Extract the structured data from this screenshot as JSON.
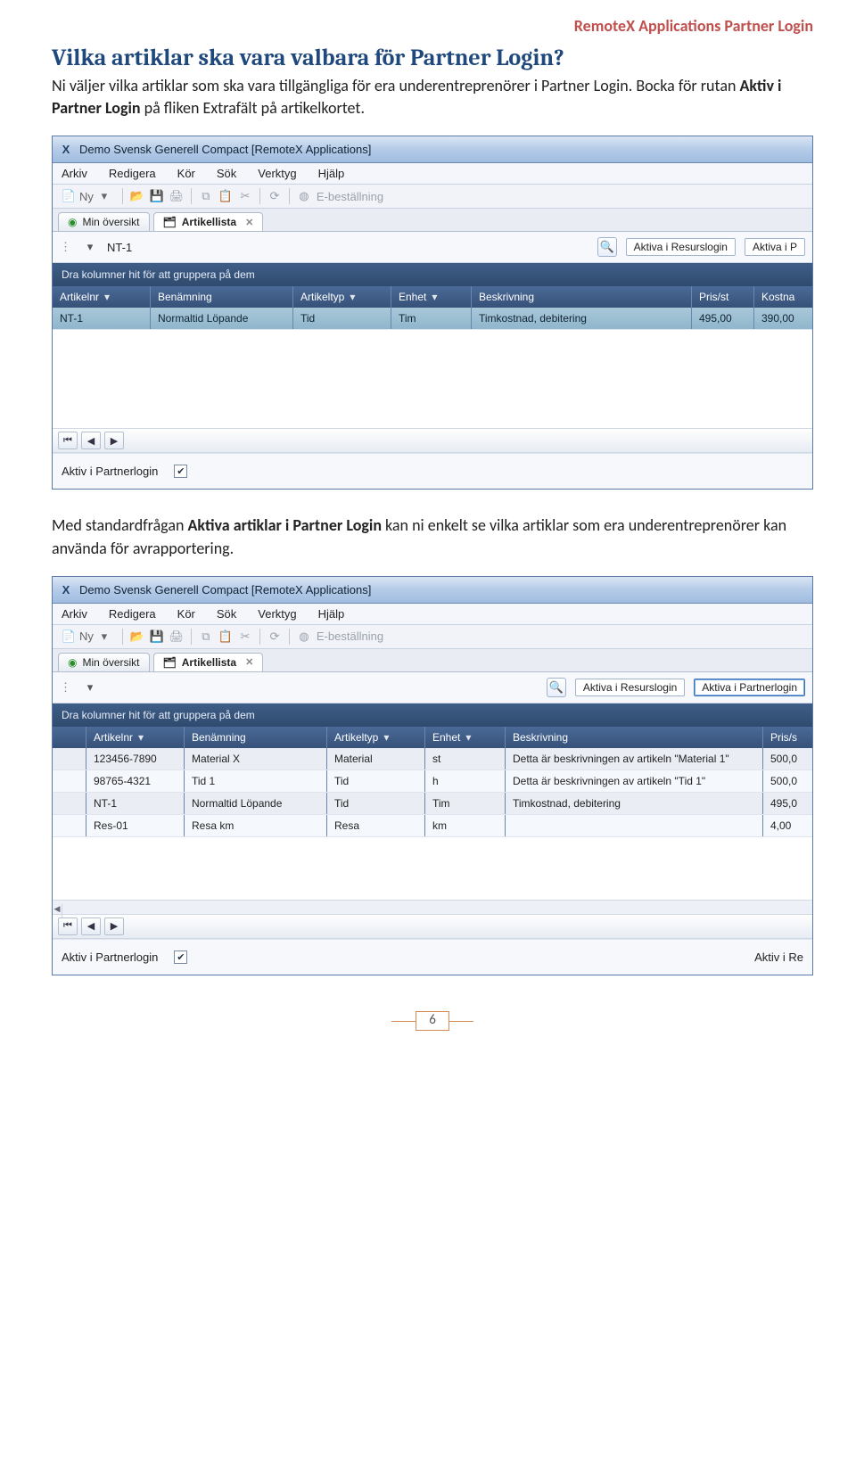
{
  "doc": {
    "header_right": "RemoteX Applications Partner Login",
    "h2": "Vilka artiklar ska vara valbara för Partner Login?",
    "para1_a": "Ni väljer vilka artiklar som ska vara tillgängliga för era underentreprenörer i Partner Login. Bocka för rutan ",
    "para1_bold": "Aktiv i Partner Login",
    "para1_b": " på fliken Extrafält på artikelkortet.",
    "para2_a": "Med standardfrågan ",
    "para2_bold": "Aktiva artiklar i Partner Login",
    "para2_b": " kan ni enkelt se vilka artiklar som era underentreprenörer kan använda för avrapportering.",
    "page_number": "6"
  },
  "app": {
    "title": "Demo Svensk Generell Compact [RemoteX Applications]",
    "menus": [
      "Arkiv",
      "Redigera",
      "Kör",
      "Sök",
      "Verktyg",
      "Hjälp"
    ],
    "toolbar_ny": "Ny",
    "toolbar_ebest": "E-beställning",
    "tab_overview": "Min översikt",
    "tab_list": "Artikellista",
    "groupbar": "Dra kolumner hit för att gruppera på dem",
    "filters": {
      "resurs": "Aktiva i Resurslogin",
      "partner_short": "Aktiva i P",
      "partner_full": "Aktiva i Partnerlogin"
    },
    "cols": {
      "artikelnr": "Artikelnr",
      "benamning": "Benämning",
      "artikeltyp": "Artikeltyp",
      "enhet": "Enhet",
      "beskrivning": "Beskrivning",
      "pris": "Pris/st",
      "kostnad_short": "Kostna",
      "pris_short": "Pris/s"
    },
    "form_label": "Aktiv i Partnerlogin",
    "right_label": "Aktiv i Re"
  },
  "shot1": {
    "search_value": "NT-1",
    "rows": [
      {
        "art": "NT-1",
        "ben": "Normaltid Löpande",
        "typ": "Tid",
        "enh": "Tim",
        "besk": "Timkostnad, debitering",
        "pris": "495,00",
        "kost": "390,00"
      }
    ]
  },
  "shot2": {
    "rows": [
      {
        "art": "123456-7890",
        "ben": "Material X",
        "typ": "Material",
        "enh": "st",
        "besk": "Detta är beskrivningen av artikeln \"Material 1\"",
        "pris": "500,0"
      },
      {
        "art": "98765-4321",
        "ben": "Tid 1",
        "typ": "Tid",
        "enh": "h",
        "besk": "Detta är beskrivningen av artikeln \"Tid 1\"",
        "pris": "500,0"
      },
      {
        "art": "NT-1",
        "ben": "Normaltid Löpande",
        "typ": "Tid",
        "enh": "Tim",
        "besk": "Timkostnad, debitering",
        "pris": "495,0"
      },
      {
        "art": "Res-01",
        "ben": "Resa km",
        "typ": "Resa",
        "enh": "km",
        "besk": "",
        "pris": "4,00"
      }
    ]
  }
}
